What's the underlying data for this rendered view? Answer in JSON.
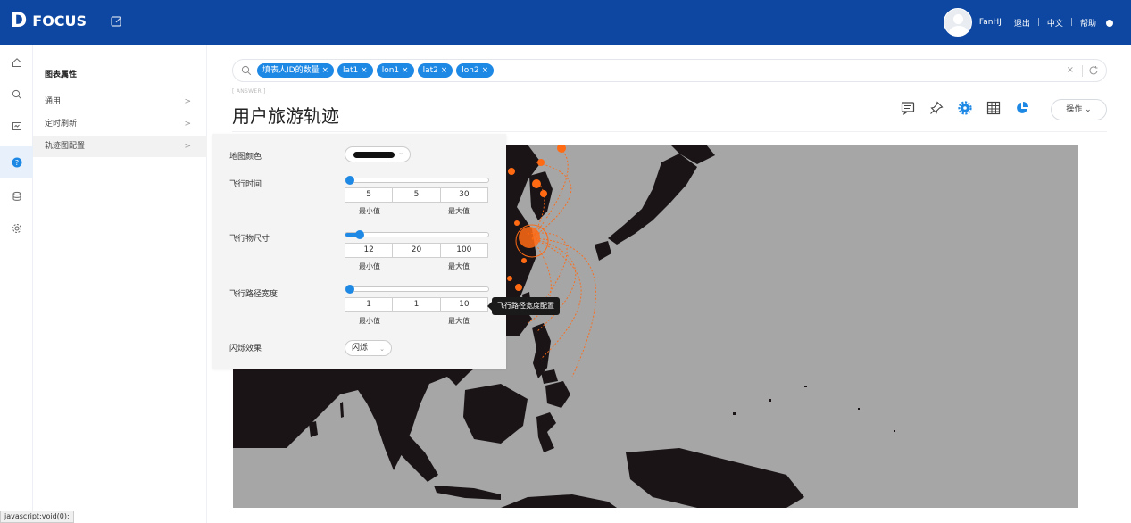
{
  "app": {
    "logo_text": "FOCUS"
  },
  "header": {
    "user_name": "FanHJ",
    "logout": "退出",
    "language": "中文",
    "help": "帮助",
    "separator": "|"
  },
  "rail_icons": [
    "home-icon",
    "search-icon",
    "dashboard-icon",
    "help-icon",
    "database-icon",
    "settings-icon"
  ],
  "sidebar": {
    "title": "图表属性",
    "items": [
      {
        "label": "通用",
        "chevron": ">"
      },
      {
        "label": "定时刷新",
        "chevron": ">"
      },
      {
        "label": "轨迹图配置",
        "chevron": ">"
      }
    ]
  },
  "search": {
    "tags": [
      {
        "label": "填表人ID的数量"
      },
      {
        "label": "lat1"
      },
      {
        "label": "lon1"
      },
      {
        "label": "lat2"
      },
      {
        "label": "lon2"
      }
    ],
    "tag_remove": "×",
    "clear": "×"
  },
  "answer": {
    "crumb": "[ ANSWER ]",
    "title": "用户旅游轨迹",
    "ops_label": "操作"
  },
  "config_panel": {
    "map_color_label": "地图颜色",
    "map_color": "#111111",
    "flight_time": {
      "label": "飞行时间",
      "value": "5",
      "min": "5",
      "max": "30",
      "level": 0
    },
    "flyer_size": {
      "label": "飞行物尺寸",
      "value": "12",
      "min": "20",
      "max": "100",
      "level": 0.1
    },
    "path_width": {
      "label": "飞行路径宽度",
      "value": "1",
      "min": "1",
      "max": "10",
      "level": 0
    },
    "min_caption": "最小值",
    "max_caption": "最大值",
    "flash_label": "闪烁效果",
    "flash_value": "闪烁"
  },
  "tooltip": {
    "text": "飞行路径宽度配置"
  },
  "status_bar": {
    "text": "javascript:void(0);"
  },
  "colors": {
    "header_bg": "#0d47a1",
    "accent": "#1e88e5",
    "map_land": "#1a1416",
    "map_sea": "#a6a6a6",
    "flight_path": "#ff6a13"
  }
}
